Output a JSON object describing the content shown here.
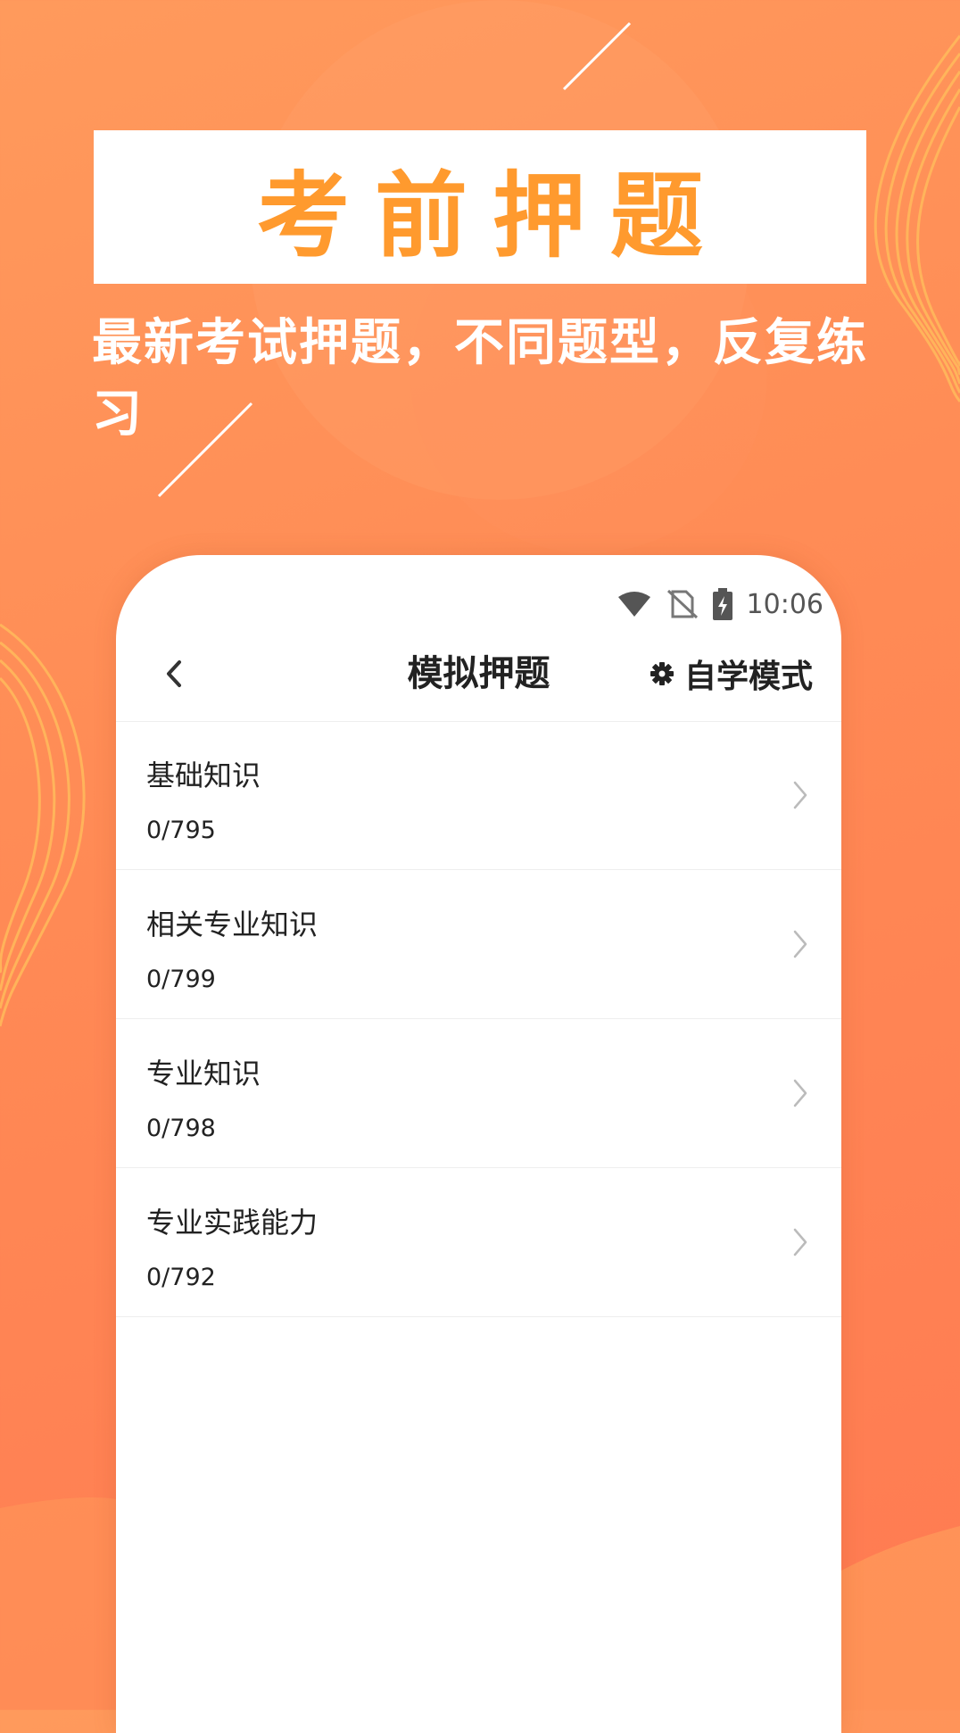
{
  "hero": {
    "title": "考前押题",
    "subtitle": "最新考试押题，不同题型，反复练习"
  },
  "status_bar": {
    "time": "10:06",
    "icons": [
      "wifi-icon",
      "no-sim-icon",
      "battery-charging-icon"
    ]
  },
  "header": {
    "back_icon": "chevron-left-icon",
    "title": "模拟押题",
    "mode_icon": "gear-icon",
    "mode_label": "自学模式"
  },
  "items": [
    {
      "title": "基础知识",
      "progress": "0/795"
    },
    {
      "title": "相关专业知识",
      "progress": "0/799"
    },
    {
      "title": "专业知识",
      "progress": "0/798"
    },
    {
      "title": "专业实践能力",
      "progress": "0/792"
    }
  ],
  "colors": {
    "background": "#ff8a55",
    "hero_title": "#ff9a2e",
    "decor_stripes": "#ffb55a"
  }
}
